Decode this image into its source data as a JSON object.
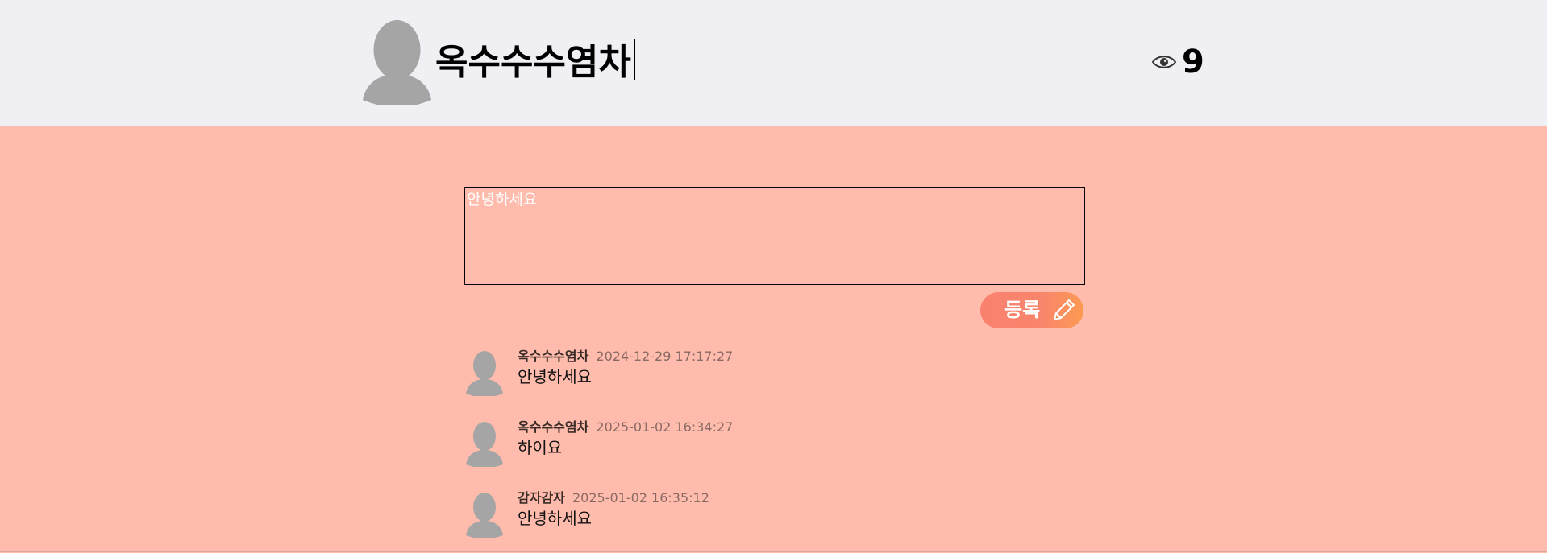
{
  "post": {
    "title": "옥수수수염차",
    "view_count": "9"
  },
  "comment_form": {
    "placeholder": "안녕하세요",
    "submit_label": "등록"
  },
  "comments": [
    {
      "author": "옥수수수염차",
      "time": "2024-12-29 17:17:27",
      "text": "안녕하세요"
    },
    {
      "author": "옥수수수염차",
      "time": "2025-01-02 16:34:27",
      "text": "하이요"
    },
    {
      "author": "감자감자",
      "time": "2025-01-02 16:35:12",
      "text": "안녕하세요"
    }
  ],
  "icons": {
    "avatar": "user-silhouette-icon",
    "views": "eye-icon",
    "submit": "pencil-icon"
  },
  "colors": {
    "header_bg": "#efeff4",
    "page_bg": "#ffbcad",
    "avatar": "#a5a5a5",
    "button": "#f9826f"
  }
}
